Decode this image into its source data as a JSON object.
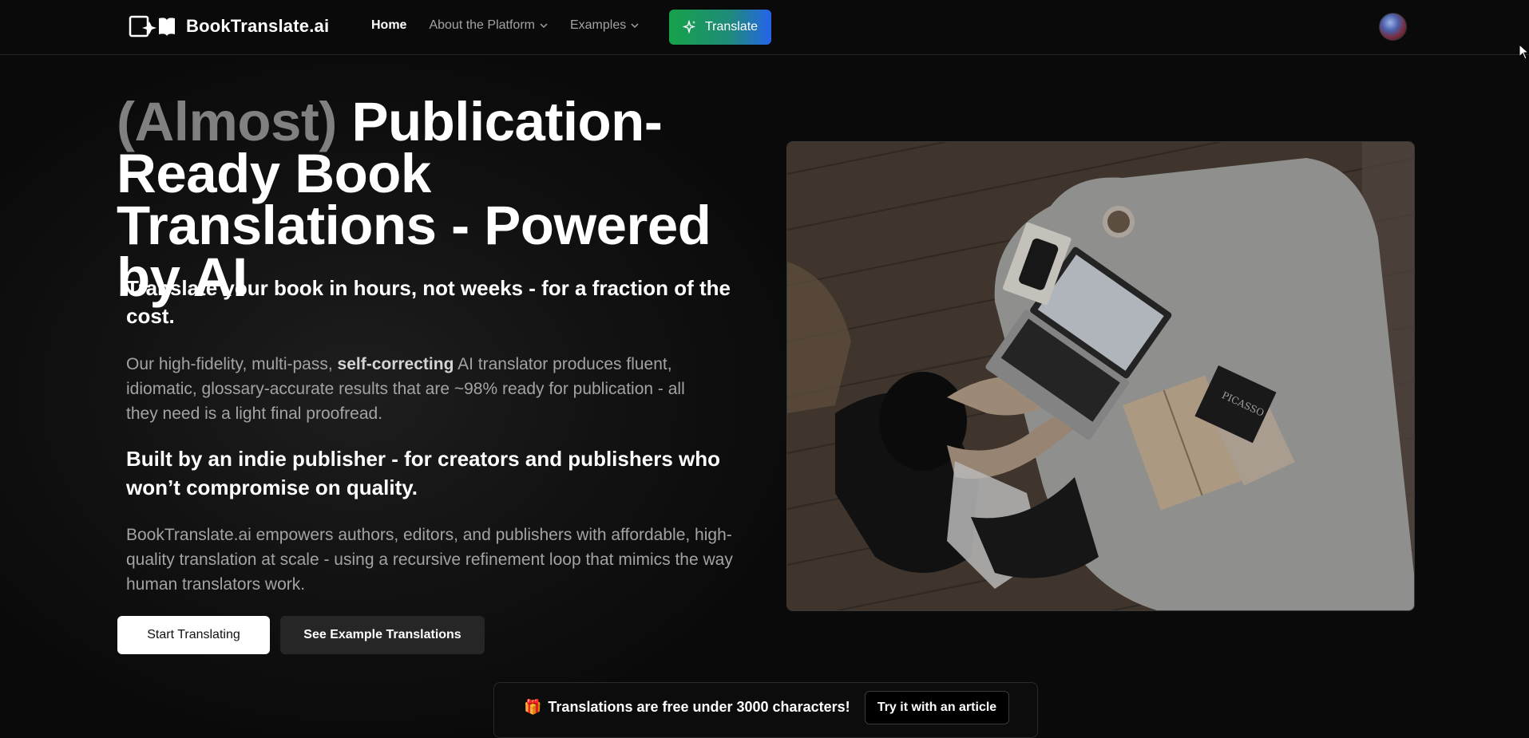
{
  "nav": {
    "brand": "BookTranslate.ai",
    "links": [
      {
        "label": "Home",
        "active": true,
        "dropdown": false
      },
      {
        "label": "About the Platform",
        "active": false,
        "dropdown": true
      },
      {
        "label": "Examples",
        "active": false,
        "dropdown": true
      }
    ],
    "translate_button": "Translate"
  },
  "hero": {
    "headline_muted": "(Almost)",
    "headline_main": " Publication-Ready Book Translations - Powered by AI",
    "subheading_1": "Translate your book in hours, not weeks - for a fraction of the cost.",
    "paragraph_1_pre": "Our high-fidelity, multi-pass, ",
    "paragraph_1_bold": "self-correcting",
    "paragraph_1_post": " AI translator produces fluent, idiomatic, glossary-accurate results that are ~98% ready for publication - all they need is a light final proofread.",
    "subheading_2": "Built by an indie publisher - for creators and publishers who won’t compromise on quality.",
    "paragraph_2": "BookTranslate.ai empowers authors, editors, and publishers with affordable, high-quality translation at scale - using a recursive refinement loop that mimics the way human translators work.",
    "primary_button": "Start Translating",
    "secondary_button": "See Example Translations"
  },
  "banner": {
    "icon": "🎁",
    "text": "Translations are free under 3000 characters!",
    "button": "Try it with an article"
  },
  "colors": {
    "background": "#0a0a0a",
    "accent_green": "#16a34a",
    "accent_blue": "#2563eb",
    "muted_text": "#a3a3a3"
  }
}
